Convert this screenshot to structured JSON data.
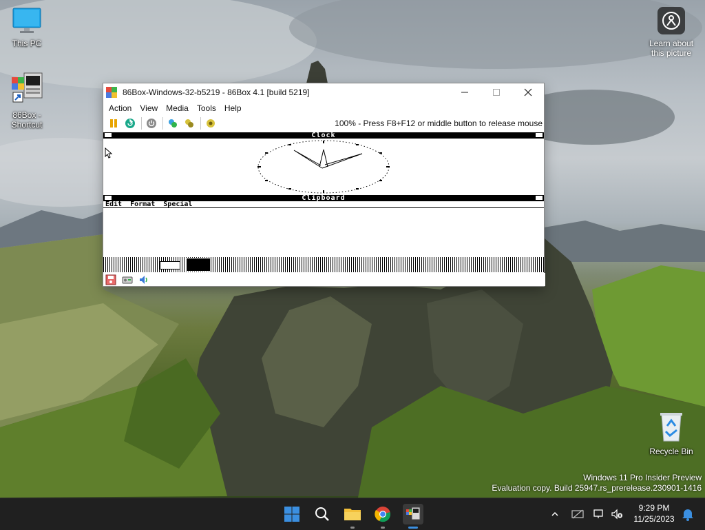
{
  "desktop": {
    "icons": [
      {
        "label": "This PC"
      },
      {
        "label": "86Box -\nShortcut"
      },
      {
        "label": "Recycle Bin"
      }
    ],
    "learn_label_1": "Learn about",
    "learn_label_2": "this picture",
    "watermark_line1": "Windows 11 Pro Insider Preview",
    "watermark_line2": "Evaluation copy. Build 25947.rs_prerelease.230901-1416"
  },
  "window": {
    "title": "86Box-Windows-32-b5219 - 86Box 4.1 [build 5219]",
    "menu": [
      "Action",
      "View",
      "Media",
      "Tools",
      "Help"
    ],
    "toolbar_status": "100% - Press F8+F12 or middle button to release mouse",
    "emulated": {
      "clock_title": "Clock",
      "clipboard_title": "Clipboard",
      "clipboard_menu": "Edit  Format  Special"
    }
  },
  "taskbar": {
    "time": "9:29 PM",
    "date": "11/25/2023"
  },
  "colors": {
    "taskbar_bg": "#202020",
    "accent_blue": "#3b8fe0"
  }
}
